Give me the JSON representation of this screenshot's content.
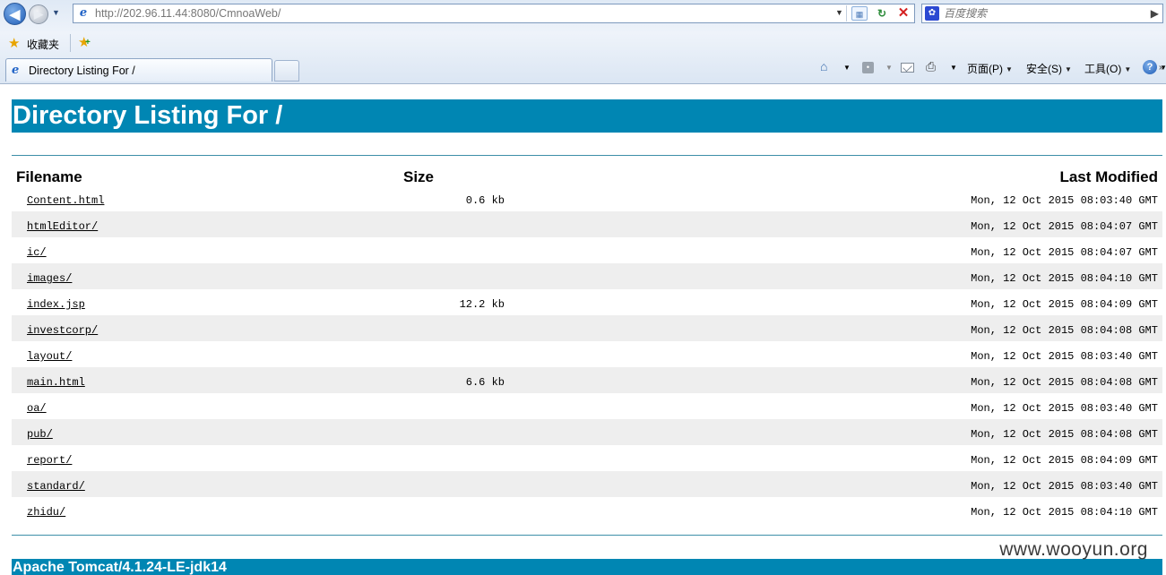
{
  "browser": {
    "address": "http://202.96.11.44:8080/CmnoaWeb/",
    "search_placeholder": "百度搜索",
    "favorites_label": "收藏夹",
    "tab_title": "Directory Listing For /",
    "commands": {
      "page": "页面(P)",
      "safety": "安全(S)",
      "tools": "工具(O)"
    },
    "icons": [
      "back-icon",
      "forward-icon",
      "ie-page-icon",
      "compat-view-icon",
      "refresh-icon",
      "stop-icon",
      "baidu-icon",
      "favorites-star-icon",
      "add-favorite-icon",
      "home-icon",
      "feeds-icon",
      "mail-icon",
      "print-icon",
      "help-icon"
    ]
  },
  "page": {
    "title": "Directory Listing For /",
    "headers": {
      "filename": "Filename",
      "size": "Size",
      "modified": "Last Modified"
    },
    "files": [
      {
        "name": "Content.html",
        "size": "0.6 kb",
        "modified": "Mon, 12 Oct 2015 08:03:40 GMT"
      },
      {
        "name": "htmlEditor/",
        "size": "",
        "modified": "Mon, 12 Oct 2015 08:04:07 GMT"
      },
      {
        "name": "ic/",
        "size": "",
        "modified": "Mon, 12 Oct 2015 08:04:07 GMT"
      },
      {
        "name": "images/",
        "size": "",
        "modified": "Mon, 12 Oct 2015 08:04:10 GMT"
      },
      {
        "name": "index.jsp",
        "size": "12.2 kb",
        "modified": "Mon, 12 Oct 2015 08:04:09 GMT"
      },
      {
        "name": "investcorp/",
        "size": "",
        "modified": "Mon, 12 Oct 2015 08:04:08 GMT"
      },
      {
        "name": "layout/",
        "size": "",
        "modified": "Mon, 12 Oct 2015 08:03:40 GMT"
      },
      {
        "name": "main.html",
        "size": "6.6 kb",
        "modified": "Mon, 12 Oct 2015 08:04:08 GMT"
      },
      {
        "name": "oa/",
        "size": "",
        "modified": "Mon, 12 Oct 2015 08:03:40 GMT"
      },
      {
        "name": "pub/",
        "size": "",
        "modified": "Mon, 12 Oct 2015 08:04:08 GMT"
      },
      {
        "name": "report/",
        "size": "",
        "modified": "Mon, 12 Oct 2015 08:04:09 GMT"
      },
      {
        "name": "standard/",
        "size": "",
        "modified": "Mon, 12 Oct 2015 08:03:40 GMT"
      },
      {
        "name": "zhidu/",
        "size": "",
        "modified": "Mon, 12 Oct 2015 08:04:10 GMT"
      }
    ],
    "footer": "Apache Tomcat/4.1.24-LE-jdk14",
    "watermark": "www.wooyun.org",
    "colors": {
      "title_bar": "#0086b3",
      "row_shade": "#eeeeee"
    }
  }
}
